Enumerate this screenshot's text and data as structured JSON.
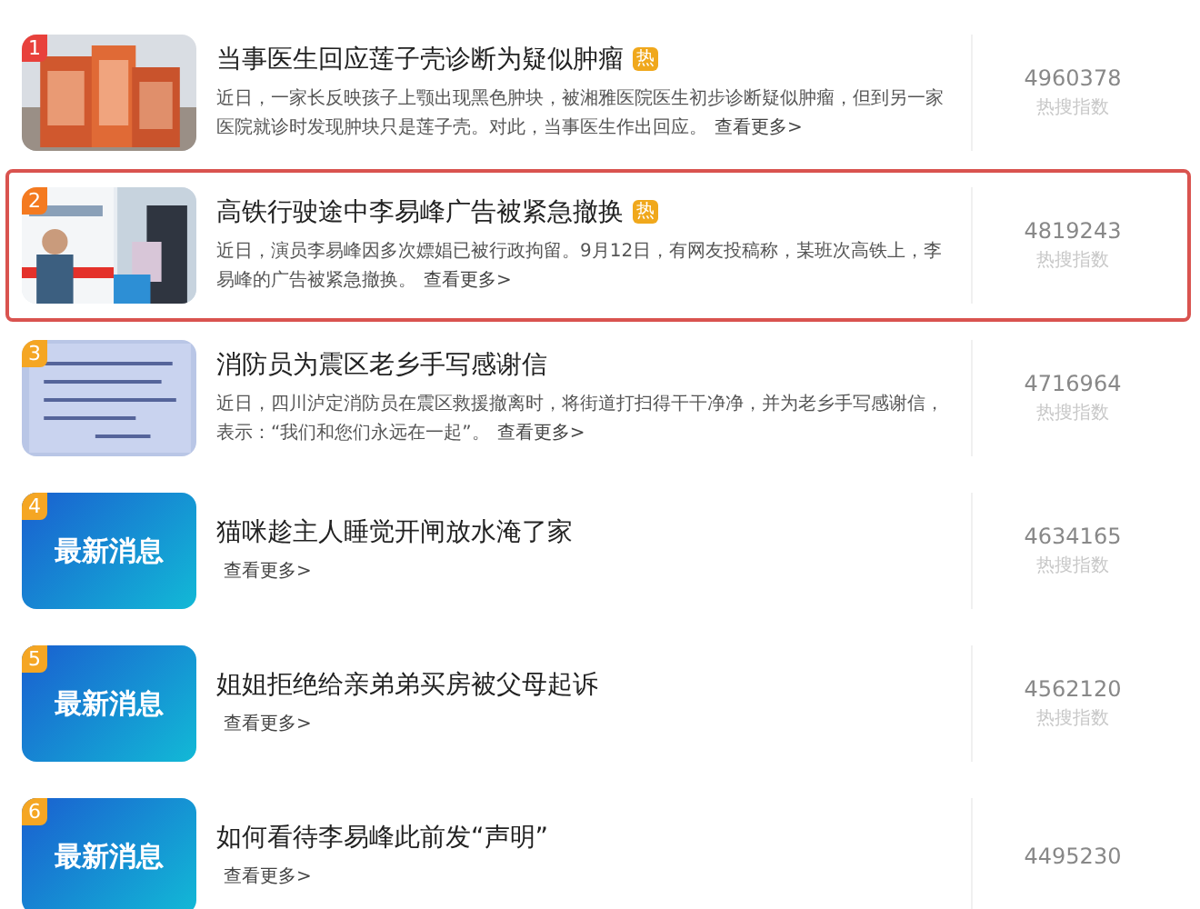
{
  "items": [
    {
      "rank": "1",
      "color": "#e8413c",
      "thumb": {
        "kind": "building"
      },
      "title": "当事医生回应莲子壳诊断为疑似肿瘤",
      "hot": true,
      "hot_label": "热",
      "desc": "近日，一家长反映孩子上颚出现黑色肿块，被湘雅医院医生初步诊断疑似肿瘤，但到另一家医院就诊时发现肿块只是莲子壳。对此，当事医生作出回应。",
      "more": "查看更多>",
      "count": "4960378",
      "count_label": "热搜指数",
      "selected": false
    },
    {
      "rank": "2",
      "color": "#f47a20",
      "thumb": {
        "kind": "person"
      },
      "title": "高铁行驶途中李易峰广告被紧急撤换",
      "hot": true,
      "hot_label": "热",
      "desc": "近日，演员李易峰因多次嫖娼已被行政拘留。9月12日，有网友投稿称，某班次高铁上，李易峰的广告被紧急撤换。",
      "more": "查看更多>",
      "count": "4819243",
      "count_label": "热搜指数",
      "selected": true
    },
    {
      "rank": "3",
      "color": "#f5a623",
      "thumb": {
        "kind": "letter"
      },
      "title": "消防员为震区老乡手写感谢信",
      "hot": false,
      "desc": "近日，四川泸定消防员在震区救援撤离时，将街道打扫得干干净净，并为老乡手写感谢信，表示：“我们和您们永远在一起”。",
      "more": "查看更多>",
      "count": "4716964",
      "count_label": "热搜指数",
      "selected": false
    },
    {
      "rank": "4",
      "color": "#f5a623",
      "thumb": {
        "kind": "banner",
        "text": "最新消息"
      },
      "title": "猫咪趁主人睡觉开闸放水淹了家",
      "hot": false,
      "more": "查看更多>",
      "count": "4634165",
      "count_label": "热搜指数",
      "selected": false
    },
    {
      "rank": "5",
      "color": "#f5a623",
      "thumb": {
        "kind": "banner",
        "text": "最新消息"
      },
      "title": "姐姐拒绝给亲弟弟买房被父母起诉",
      "hot": false,
      "more": "查看更多>",
      "count": "4562120",
      "count_label": "热搜指数",
      "selected": false
    },
    {
      "rank": "6",
      "color": "#f5a623",
      "thumb": {
        "kind": "banner",
        "text": "最新消息"
      },
      "title": "如何看待李易峰此前发“声明”",
      "hot": false,
      "more": "查看更多>",
      "count": "4495230",
      "selected": false
    }
  ]
}
